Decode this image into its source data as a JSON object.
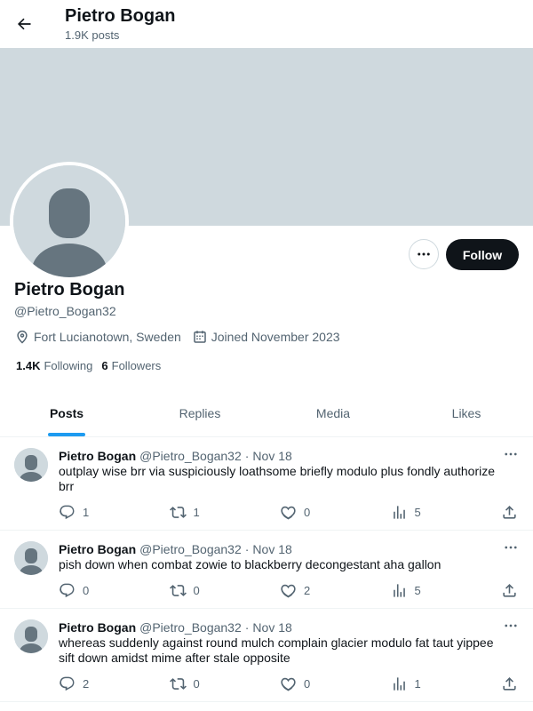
{
  "header": {
    "title": "Pietro Bogan",
    "subtitle": "1.9K posts"
  },
  "profile": {
    "name": "Pietro Bogan",
    "handle": "@Pietro_Bogan32",
    "location": "Fort Lucianotown, Sweden",
    "joined": "Joined November 2023",
    "following_count": "1.4K",
    "following_label": "Following",
    "followers_count": "6",
    "followers_label": "Followers",
    "follow_label": "Follow"
  },
  "tabs": [
    "Posts",
    "Replies",
    "Media",
    "Likes"
  ],
  "posts": [
    {
      "author": "Pietro Bogan",
      "handle": "@Pietro_Bogan32",
      "dot": "·",
      "date": "Nov 18",
      "text": "outplay wise brr via suspiciously loathsome briefly modulo plus fondly authorize brr",
      "replies": "1",
      "reposts": "1",
      "likes": "0",
      "views": "5"
    },
    {
      "author": "Pietro Bogan",
      "handle": "@Pietro_Bogan32",
      "dot": "·",
      "date": "Nov 18",
      "text": "pish down when combat zowie to blackberry decongestant aha gallon",
      "replies": "0",
      "reposts": "0",
      "likes": "2",
      "views": "5"
    },
    {
      "author": "Pietro Bogan",
      "handle": "@Pietro_Bogan32",
      "dot": "·",
      "date": "Nov 18",
      "text": "whereas suddenly against round mulch complain glacier modulo fat taut yippee sift down amidst mime after stale opposite",
      "replies": "2",
      "reposts": "0",
      "likes": "0",
      "views": "1"
    }
  ],
  "icons": {
    "back": "arrow-left-icon",
    "more": "more-horizontal-icon",
    "location": "location-pin-icon",
    "calendar": "calendar-icon",
    "reply": "reply-icon",
    "repost": "repost-icon",
    "like": "heart-icon",
    "views": "views-icon",
    "share": "share-icon"
  },
  "colors": {
    "accent": "#1d9bf0",
    "banner": "#cfd9de",
    "text": "#0f1419",
    "secondary": "#536471"
  }
}
